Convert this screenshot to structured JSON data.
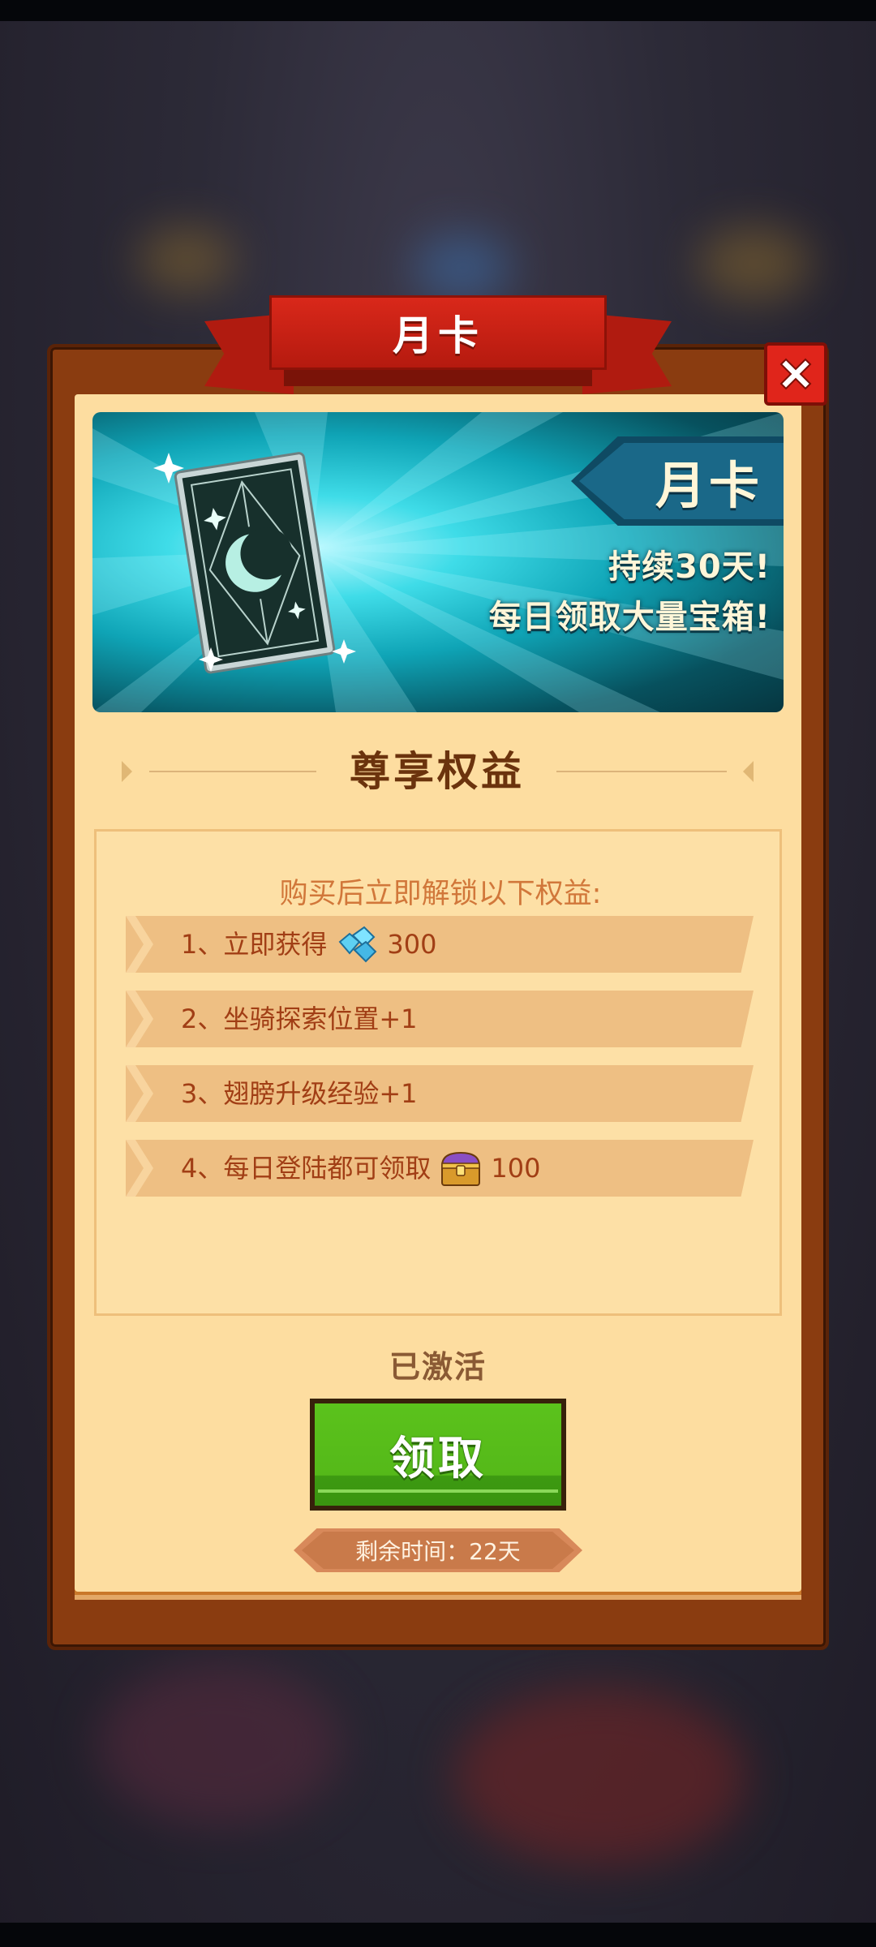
{
  "dialog": {
    "title": "月卡",
    "close_icon": "close-icon"
  },
  "banner": {
    "tag": "月卡",
    "line1": "持续30天!",
    "line2": "每日领取大量宝箱!",
    "image": "moon-tarot-card-icon"
  },
  "section": {
    "title": "尊享权益"
  },
  "benefits": {
    "header": "购买后立即解锁以下权益:",
    "items": [
      {
        "prefix": "1、立即获得",
        "icon": "diamond-gem-icon",
        "value": "300"
      },
      {
        "prefix": "2、坐骑探索位置+1",
        "icon": "",
        "value": ""
      },
      {
        "prefix": "3、翅膀升级经验+1",
        "icon": "",
        "value": ""
      },
      {
        "prefix": "4、每日登陆都可领取",
        "icon": "treasure-chest-icon",
        "value": "100"
      }
    ]
  },
  "status": "已激活",
  "claim_button": "领取",
  "remaining_time": "剩余时间：22天",
  "colors": {
    "ribbon": "#d9281a",
    "panel_frame": "#8a3c10",
    "panel_fill": "#fddda0",
    "claim_green": "#5bc21c",
    "text_brown": "#a13e15"
  }
}
